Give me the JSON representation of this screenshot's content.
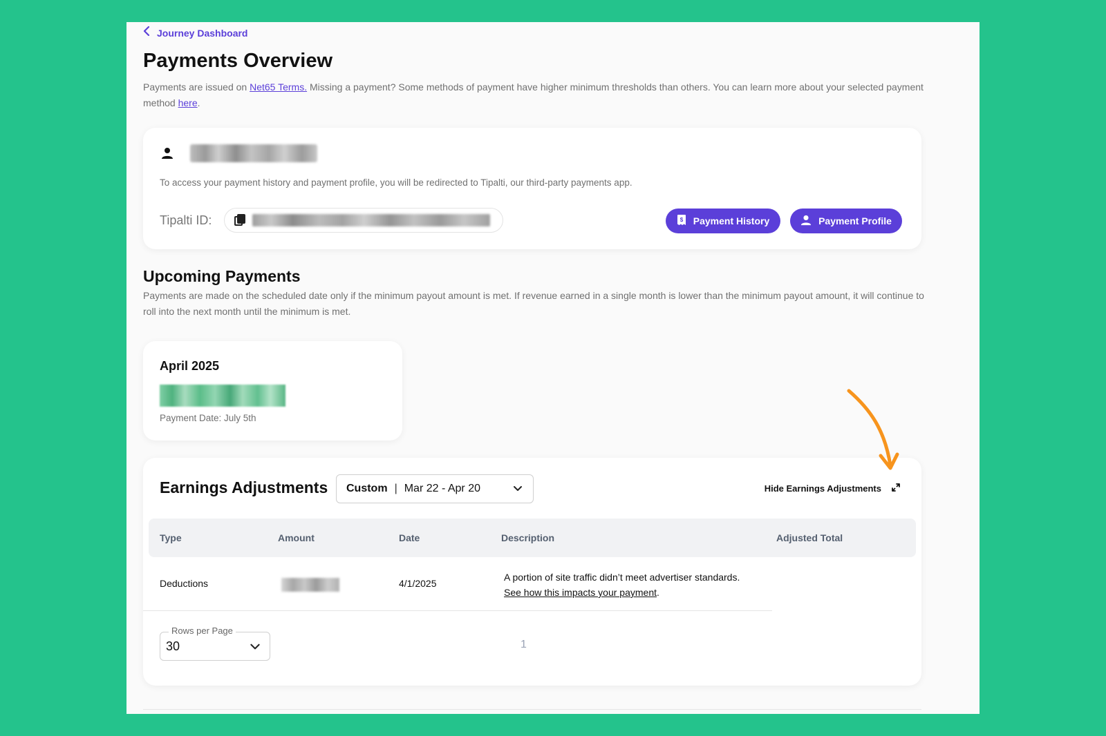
{
  "nav": {
    "back_label": "Journey Dashboard"
  },
  "page": {
    "title": "Payments Overview",
    "intro_prefix": "Payments are issued on ",
    "intro_link_terms": "Net65 Terms.",
    "intro_middle": " Missing a payment? Some methods of payment have higher minimum thresholds than others. You can learn more about your selected payment method ",
    "intro_link_here": "here",
    "intro_suffix": "."
  },
  "profile": {
    "redirect_text": "To access your payment history and payment profile, you will be redirected to Tipalti, our third-party payments app.",
    "tipalti_label": "Tipalti ID:",
    "payment_history_label": "Payment History",
    "payment_profile_label": "Payment Profile"
  },
  "upcoming": {
    "title": "Upcoming Payments",
    "description": "Payments are made on the scheduled date only if the minimum payout amount is met. If revenue earned in a single month is lower than the minimum payout amount, it will continue to roll into the next month until the minimum is met.",
    "month": "April 2025",
    "payment_date": "Payment Date: July 5th"
  },
  "earnings": {
    "title": "Earnings Adjustments",
    "range_mode": "Custom",
    "range_sep": "|",
    "range_value": "Mar 22 - Apr 20",
    "hide_label": "Hide Earnings Adjustments",
    "columns": [
      "Type",
      "Amount",
      "Date",
      "Description",
      "Adjusted Total"
    ],
    "rows": [
      {
        "type": "Deductions",
        "date": "4/1/2025",
        "description": "A portion of site traffic didn’t meet advertiser standards.",
        "link": "See how this impacts your payment",
        "link_suffix": "."
      }
    ],
    "rows_per_page_label": "Rows per Page",
    "rows_per_page_value": "30",
    "page_number": "1"
  },
  "colors": {
    "background": "#24c38c",
    "accent": "#5b3fd9",
    "annotation_arrow": "#f7941d"
  },
  "icons": [
    "chevron-left-icon",
    "person-icon",
    "copy-icon",
    "receipt-icon",
    "chevron-down-icon",
    "expand-icon",
    "annotation-arrow-icon"
  ]
}
